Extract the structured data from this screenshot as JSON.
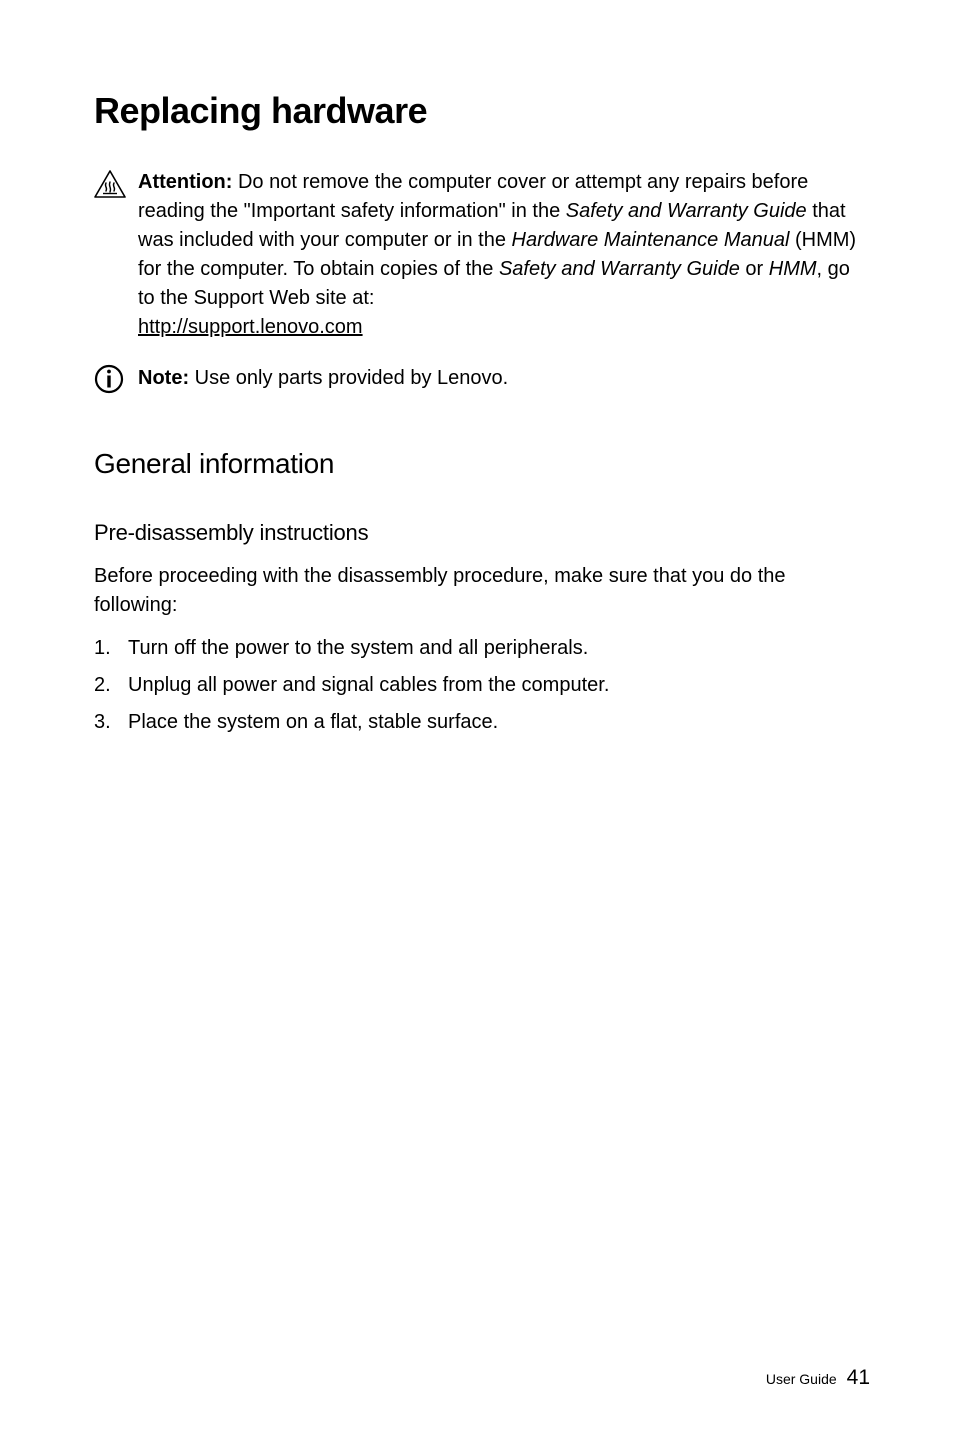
{
  "headings": {
    "main": "Replacing hardware",
    "section": "General information",
    "sub": "Pre-disassembly instructions"
  },
  "callouts": {
    "attention": {
      "label": "Attention:",
      "text_1": " Do not remove the computer cover or attempt any repairs before reading the \"Important safety information\" in the ",
      "italic_1": "Safety and Warranty Guide",
      "text_2": " that was included with your computer or in the ",
      "italic_2": "Hardware Maintenance Manual",
      "text_3": " (HMM) for the computer. To obtain copies of the ",
      "italic_3": "Safety and Warranty Guide",
      "text_4": " or ",
      "italic_4": "HMM",
      "text_5": ", go to the Support Web site at: ",
      "link": "http://support.lenovo.com"
    },
    "note": {
      "label": "Note:",
      "text": " Use only parts provided by Lenovo."
    }
  },
  "body": {
    "intro": "Before proceeding with the disassembly procedure, make sure that you do the following:"
  },
  "list": {
    "item_1": "Turn off the power to the system and all peripherals.",
    "item_2": "Unplug all power and signal cables from the computer.",
    "item_3": "Place the system on a flat, stable surface."
  },
  "footer": {
    "label": "User Guide",
    "page": "41"
  }
}
